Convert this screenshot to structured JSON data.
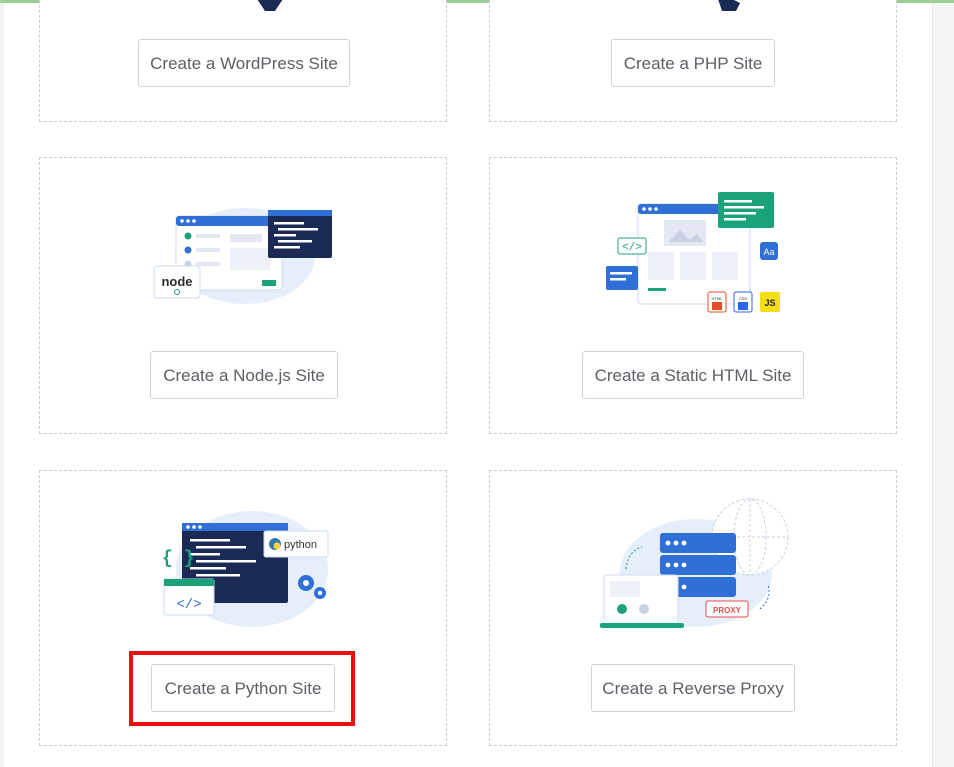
{
  "cards": {
    "wordpress": {
      "button_label": "Create a WordPress Site"
    },
    "php": {
      "button_label": "Create a PHP Site"
    },
    "nodejs": {
      "button_label": "Create a Node.js Site",
      "logo_text": "node"
    },
    "static_html": {
      "button_label": "Create a Static HTML Site",
      "badges": [
        "HTML",
        "CSS",
        "JS"
      ],
      "font_badge": "Aa"
    },
    "python": {
      "button_label": "Create a Python Site",
      "logo_text": "python"
    },
    "reverse_proxy": {
      "button_label": "Create a Reverse Proxy",
      "tag_text": "PROXY"
    }
  },
  "highlight": {
    "color": "#ea0f10",
    "target": "python"
  },
  "colors": {
    "primary_blue": "#2f6fd6",
    "navy": "#1b2a55",
    "teal": "#1aa37a",
    "card_border": "#c9ccd1"
  }
}
